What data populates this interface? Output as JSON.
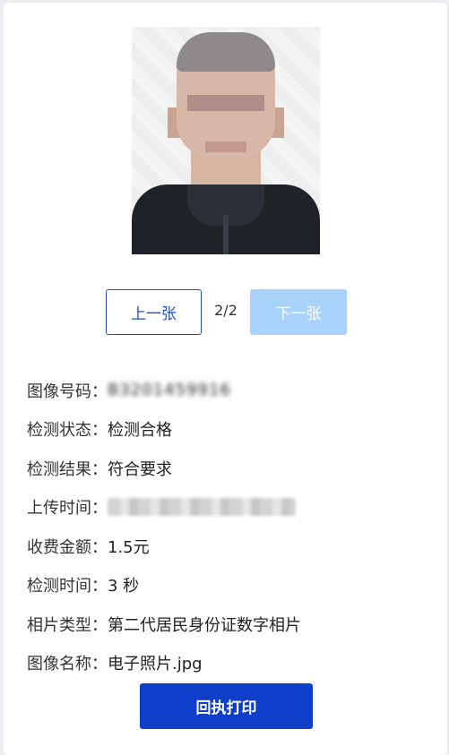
{
  "photo": {
    "icon": "person-portrait"
  },
  "pager": {
    "prev_label": "上一张",
    "counter": "2/2",
    "next_label": "下一张"
  },
  "details": {
    "image_number_label": "图像号码：",
    "image_number_value": "B3201459916",
    "status_label": "检测状态：",
    "status_value": "检测合格",
    "result_label": "检测结果：",
    "result_value": "符合要求",
    "upload_time_label": "上传时间：",
    "fee_label": "收费金额：",
    "fee_value": "1.5元",
    "duration_label": "检测时间：",
    "duration_value": "3 秒",
    "photo_type_label": "相片类型：",
    "photo_type_value": "第二代居民身份证数字相片",
    "image_name_label": "图像名称：",
    "image_name_value": "电子照片.jpg"
  },
  "actions": {
    "print_label": "回执打印"
  },
  "colors": {
    "primary": "#0f3ec9",
    "outline": "#1f4fbf",
    "disabled": "#a9d2fb"
  }
}
